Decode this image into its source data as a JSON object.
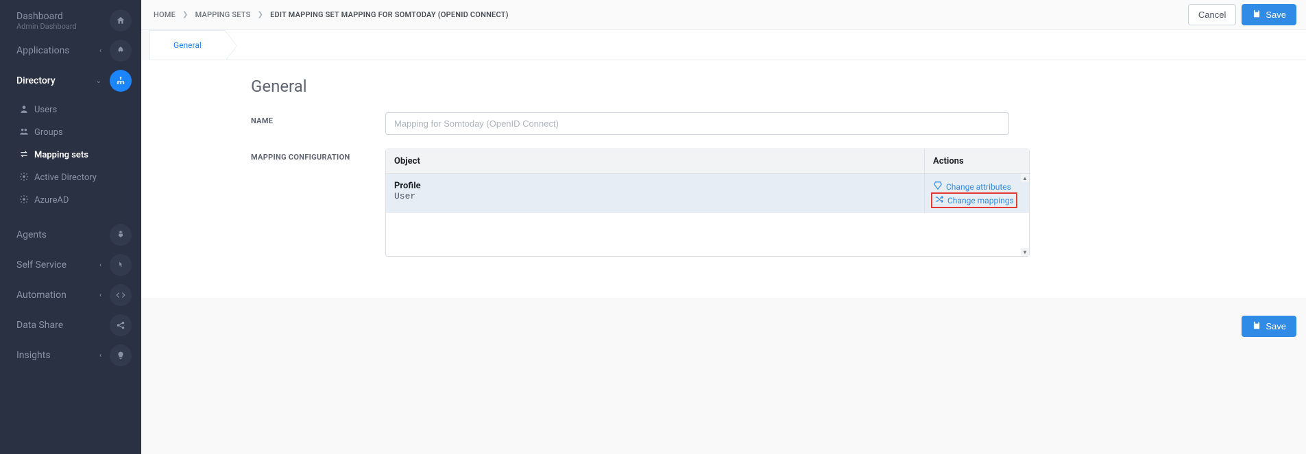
{
  "sidebar": {
    "dashboard": {
      "label": "Dashboard",
      "sublabel": "Admin Dashboard"
    },
    "applications": {
      "label": "Applications"
    },
    "directory": {
      "label": "Directory"
    },
    "directory_items": {
      "users": "Users",
      "groups": "Groups",
      "mapping_sets": "Mapping sets",
      "active_directory": "Active Directory",
      "azure_ad": "AzureAD"
    },
    "agents": {
      "label": "Agents"
    },
    "self_service": {
      "label": "Self Service"
    },
    "automation": {
      "label": "Automation"
    },
    "data_share": {
      "label": "Data Share"
    },
    "insights": {
      "label": "Insights"
    }
  },
  "breadcrumb": {
    "home": "Home",
    "mapping_sets": "Mapping Sets",
    "current": "Edit Mapping Set Mapping for Somtoday (OpenID Connect)"
  },
  "buttons": {
    "cancel": "Cancel",
    "save": "Save"
  },
  "tabs": {
    "general": "General"
  },
  "form": {
    "heading": "General",
    "name_label": "Name",
    "name_value": "Mapping for Somtoday (OpenID Connect)",
    "mapping_label": "Mapping Configuration",
    "columns": {
      "object": "Object",
      "actions": "Actions"
    },
    "row": {
      "title": "Profile",
      "desc": "User",
      "change_attributes": "Change attributes",
      "change_mappings": "Change mappings"
    }
  }
}
